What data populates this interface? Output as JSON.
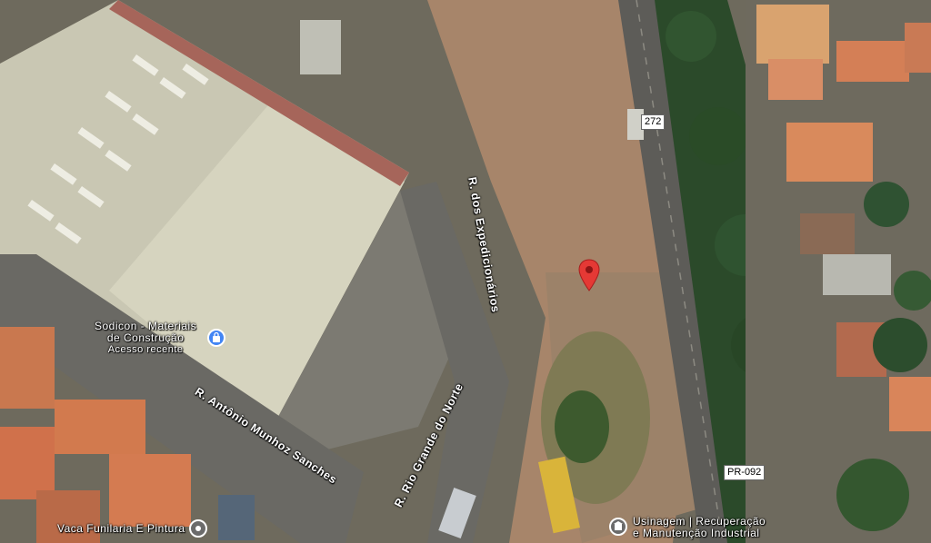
{
  "map": {
    "streets": {
      "expedicionarios": "R. dos Expedicionários",
      "antonio_munhoz": "R. Antônio Munhoz Sanches",
      "rio_grande_norte": "R. Rio Grande do Norte"
    },
    "pois": {
      "sodicon_name": "Sodicon - Materiais de Construção",
      "sodicon_line1": "Sodicon - Materiais",
      "sodicon_line2": "de Construção",
      "sodicon_sub": "Acesso recente",
      "vaca_funilaria": "Vaca Funilaria E Pintura",
      "usinagem_line1": "Usinagem | Recuperação",
      "usinagem_line2": "e Manutenção Industrial"
    },
    "road_shields": {
      "br272": "272",
      "pr092": "PR-092"
    },
    "colors": {
      "pin": "#e53935",
      "poi_blue": "#4285f4",
      "poi_grey": "#6b6b6b"
    }
  }
}
